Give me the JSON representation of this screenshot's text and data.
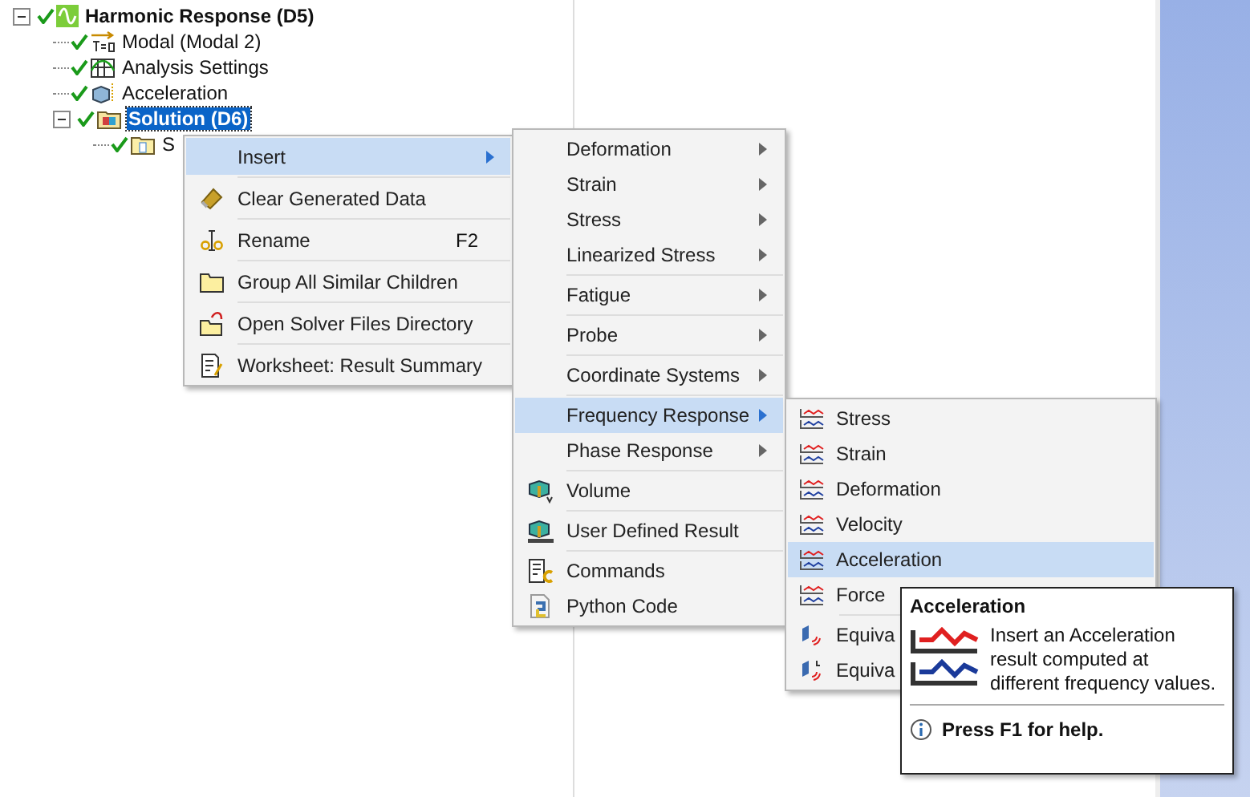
{
  "tree": [
    {
      "label": "Harmonic Response (D5)",
      "kind": "harmonic",
      "expanded": true,
      "selected": false,
      "children": [
        {
          "label": "Modal (Modal 2)",
          "kind": "modal",
          "selected": false
        },
        {
          "label": "Analysis Settings",
          "kind": "settings",
          "selected": false
        },
        {
          "label": "Acceleration",
          "kind": "accel",
          "selected": false
        },
        {
          "label": "Solution (D6)",
          "kind": "solution",
          "expanded": true,
          "selected": true,
          "children": [
            {
              "label": "S",
              "kind": "info-folder",
              "selected": false
            }
          ]
        }
      ]
    }
  ],
  "context_menu": [
    {
      "label": "Insert",
      "submenu": true,
      "selected": true
    },
    {
      "label": "Clear Generated Data",
      "kind": "eraser",
      "divider": true,
      "selected": false
    },
    {
      "label": "Rename",
      "kind": "rename",
      "shortcut": "F2",
      "divider": true,
      "selected": false
    },
    {
      "label": "Group All Similar Children",
      "kind": "folder",
      "divider": true,
      "selected": false
    },
    {
      "label": "Open Solver Files Directory",
      "kind": "folder-open",
      "divider": true,
      "selected": false
    },
    {
      "label": "Worksheet: Result Summary",
      "kind": "worksheet",
      "divider": true,
      "selected": false
    }
  ],
  "insert_menu": [
    {
      "label": "Deformation",
      "submenu": true,
      "selected": false
    },
    {
      "label": "Strain",
      "submenu": true,
      "selected": false
    },
    {
      "label": "Stress",
      "submenu": true,
      "selected": false
    },
    {
      "label": "Linearized Stress",
      "submenu": true,
      "selected": false
    },
    {
      "label": "Fatigue",
      "submenu": true,
      "divider": true,
      "selected": false
    },
    {
      "label": "Probe",
      "submenu": true,
      "divider": true,
      "selected": false
    },
    {
      "label": "Coordinate Systems",
      "submenu": true,
      "divider": true,
      "selected": false
    },
    {
      "label": "Frequency Response",
      "submenu": true,
      "divider": true,
      "selected": true
    },
    {
      "label": "Phase Response",
      "submenu": true,
      "selected": false
    },
    {
      "label": "Volume",
      "kind": "volume",
      "divider": true,
      "selected": false
    },
    {
      "label": "User Defined Result",
      "kind": "user-result",
      "divider": true,
      "selected": false
    },
    {
      "label": "Commands",
      "kind": "commands",
      "divider": true,
      "selected": false
    },
    {
      "label": "Python Code",
      "kind": "python",
      "selected": false
    }
  ],
  "frequency_menu": [
    {
      "label": "Stress",
      "kind": "freq",
      "selected": false
    },
    {
      "label": "Strain",
      "kind": "freq",
      "selected": false
    },
    {
      "label": "Deformation",
      "kind": "freq",
      "selected": false
    },
    {
      "label": "Velocity",
      "kind": "freq",
      "selected": false
    },
    {
      "label": "Acceleration",
      "kind": "freq",
      "selected": true
    },
    {
      "label": "Force",
      "kind": "freq",
      "selected": false
    },
    {
      "label": "Equiva",
      "kind": "equiv",
      "divider": true,
      "selected": false
    },
    {
      "label": "Equiva",
      "kind": "equiv-l",
      "selected": false
    }
  ],
  "tooltip": {
    "title": "Acceleration",
    "text": "Insert an Acceleration result computed at different frequency values.",
    "help": "Press F1 for help."
  }
}
